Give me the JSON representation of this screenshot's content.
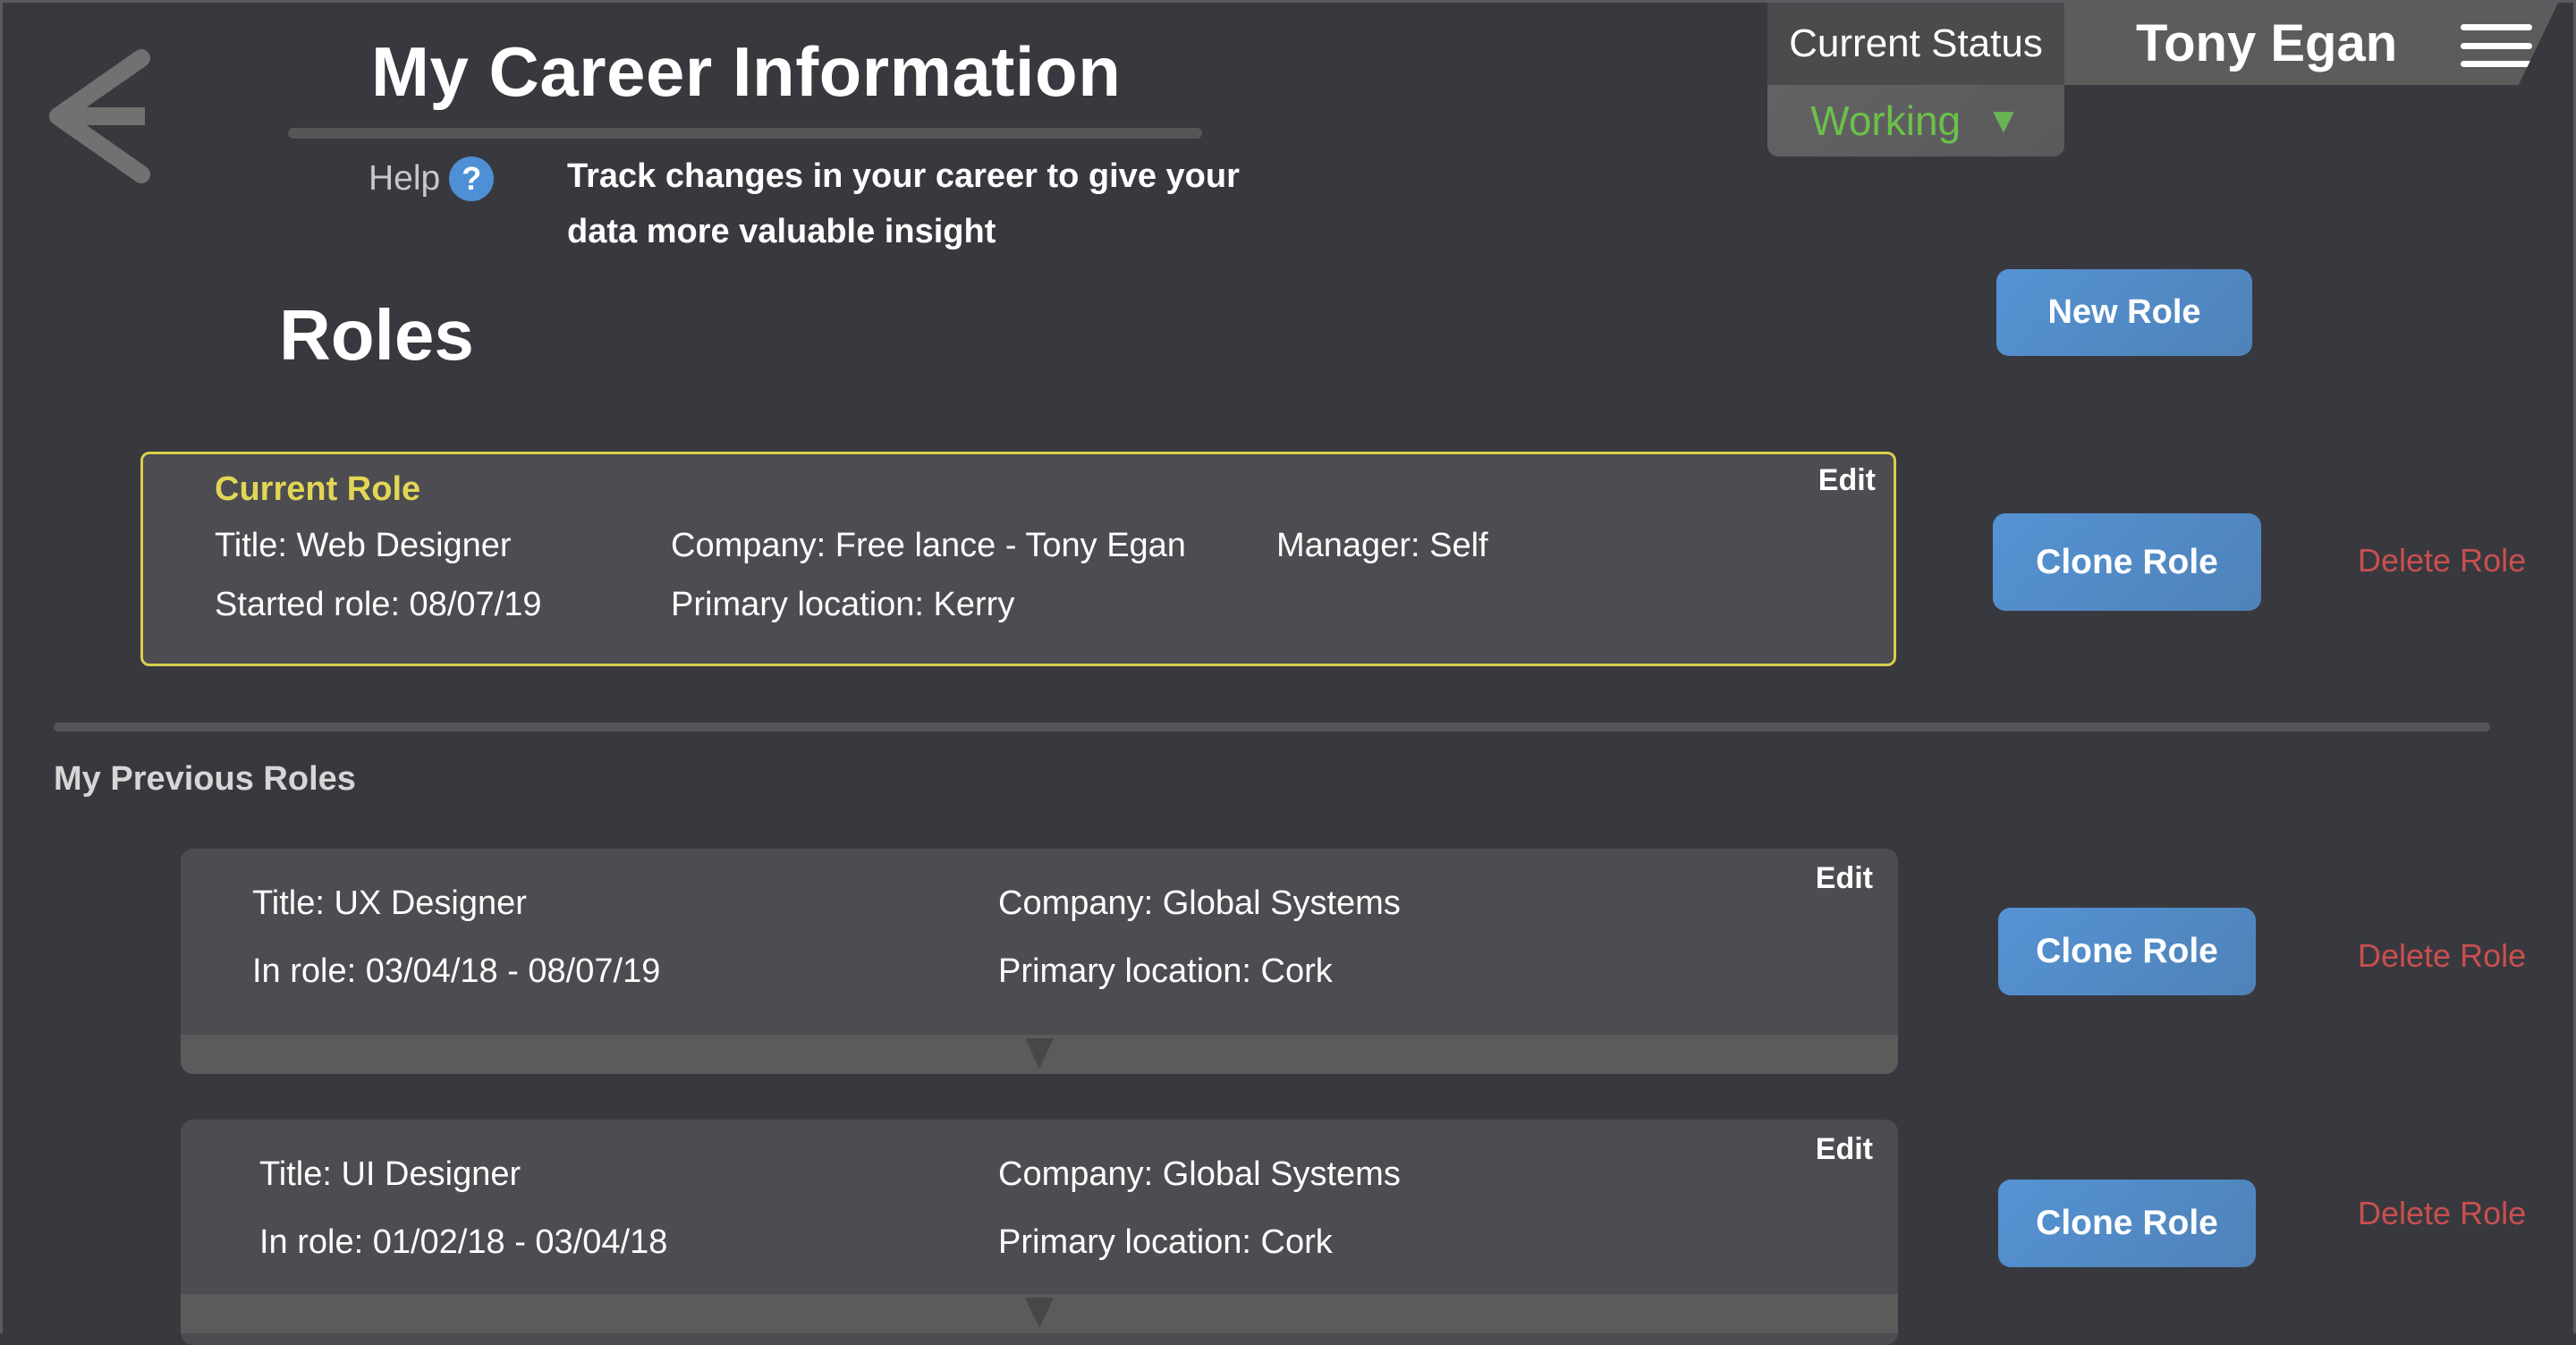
{
  "header": {
    "title": "My Career Information",
    "help_label": "Help",
    "help_icon": "question-circle-icon",
    "description": "Track changes in your career to give your data more valuable insight",
    "back_icon": "arrow-left-icon"
  },
  "status": {
    "label": "Current Status",
    "value": "Working",
    "caret": "▼",
    "value_color": "#6cc04a"
  },
  "user": {
    "name": "Tony Egan",
    "menu_icon": "hamburger-menu-icon"
  },
  "roles": {
    "heading": "Roles",
    "new_role_label": "New Role",
    "current": {
      "heading": "Current Role",
      "edit_label": "Edit",
      "title": "Title: Web Designer",
      "company": "Company: Free lance - Tony Egan",
      "manager": "Manager: Self",
      "started": "Started role: 08/07/19",
      "location": "Primary location: Kerry",
      "clone_label": "Clone Role",
      "delete_label": "Delete Role",
      "border_color": "#d9cf4e"
    },
    "previous_heading": "My Previous Roles",
    "previous": [
      {
        "edit_label": "Edit",
        "title": "Title: UX Designer",
        "company": "Company: Global Systems",
        "period": "In role: 03/04/18 - 08/07/19",
        "location": "Primary location: Cork",
        "clone_label": "Clone Role",
        "delete_label": "Delete Role"
      },
      {
        "edit_label": "Edit",
        "title": "Title: UI Designer",
        "company": "Company: Global Systems",
        "period": "In role: 01/02/18 - 03/04/18",
        "location": "Primary location: Cork",
        "clone_label": "Clone Role",
        "delete_label": "Delete Role"
      }
    ]
  },
  "colors": {
    "background": "#38393e",
    "accent_blue": "#5190d2",
    "delete_red": "#c94f4f",
    "current_highlight": "#e1d656"
  }
}
